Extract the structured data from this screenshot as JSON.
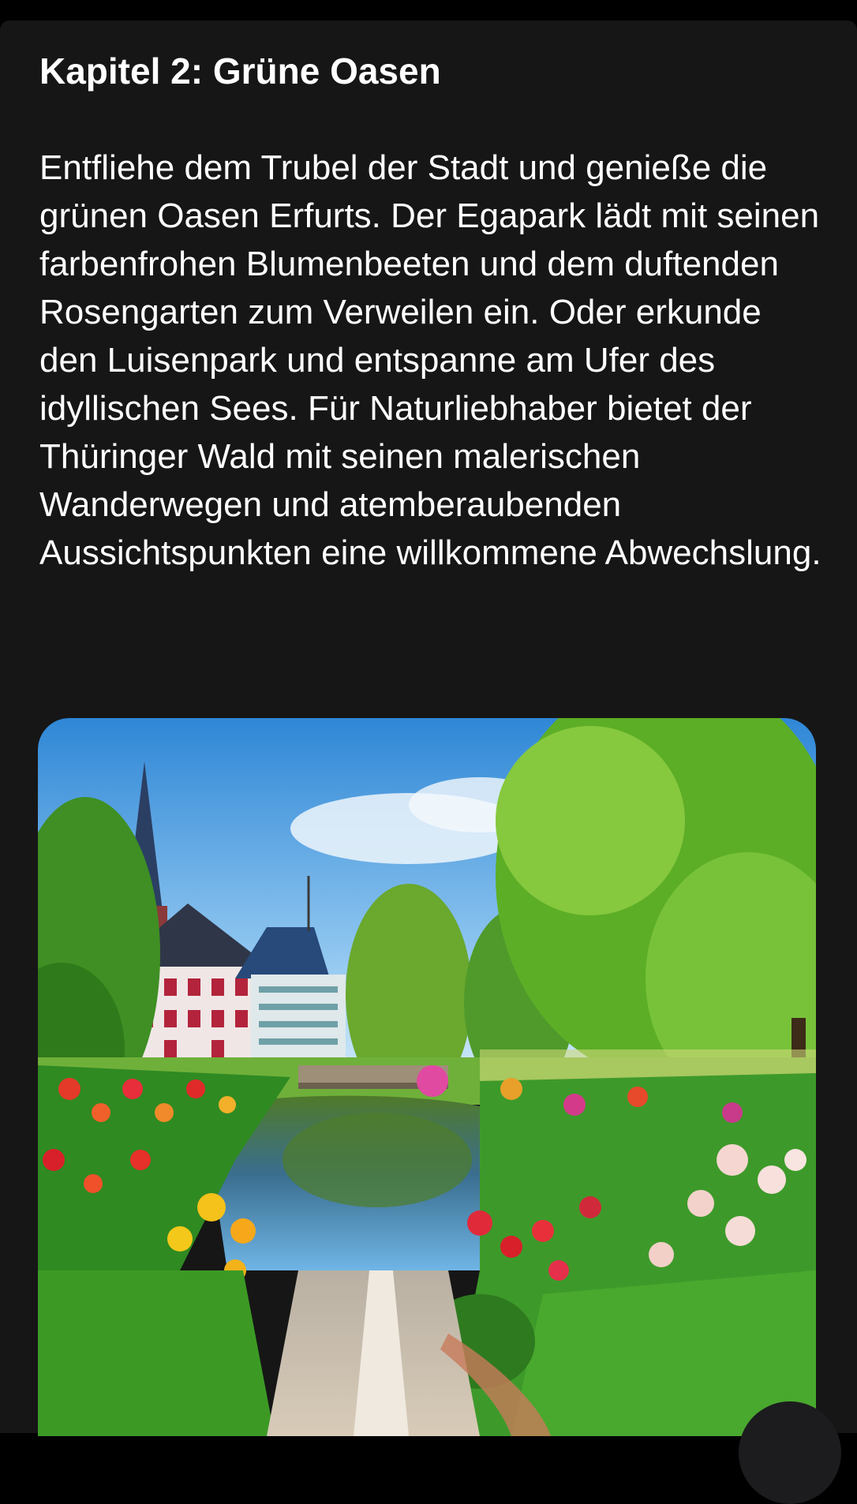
{
  "article": {
    "chapter_title": "Kapitel 2: Grüne Oasen",
    "paragraph": "Entfliehe dem Trubel der Stadt und genieße die grünen Oasen Erfurts. Der Egapark lädt mit seinen farbenfrohen Blumenbeeten und dem duftenden Rosengarten zum Verweilen ein. Oder erkunde den Luisenpark und entspanne am Ufer des idyllischen Sees. Für Naturliebhaber bietet der Thüringer Wald mit seinen malerischen Wanderwegen und atemberaubenden Aussichtspunkten eine willkommene Abwechslung."
  },
  "colors": {
    "page_background": "#161616",
    "text": "#ffffff",
    "top_bar": "#000000"
  }
}
